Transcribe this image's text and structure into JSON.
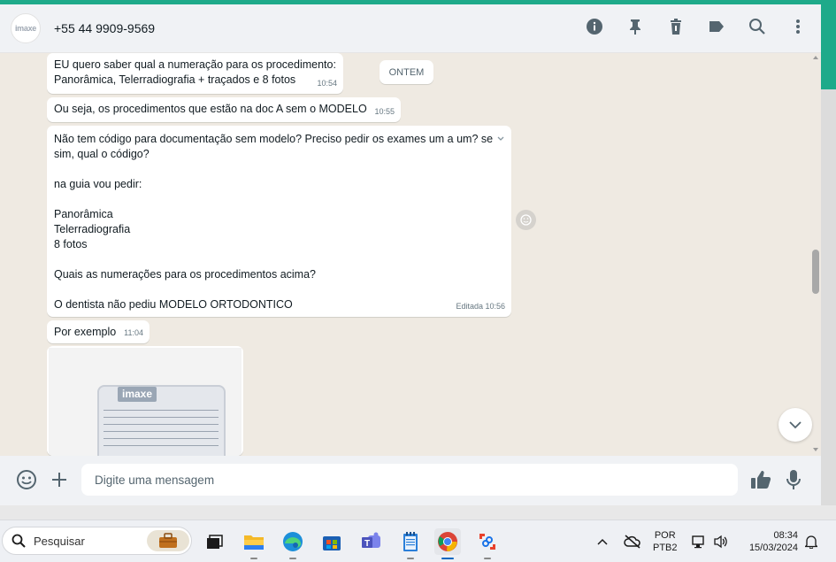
{
  "header": {
    "avatar_text": "imaxe",
    "contact": "+55 44 9909-9569",
    "icons": [
      "info-icon",
      "pin-icon",
      "trash-icon",
      "label-icon",
      "search-icon",
      "more-vertical-icon"
    ]
  },
  "chat": {
    "date_chip": "ONTEM",
    "messages": [
      {
        "text": "EU quero saber qual a numeração para os procedimento:\nPanorâmica, Telerradiografia + traçados e 8 fotos",
        "time": "10:54"
      },
      {
        "text": "Ou seja, os procedimentos que estão na doc A sem o MODELO",
        "time": "10:55"
      },
      {
        "text": "Não tem código para documentação sem modelo? Preciso pedir os exames um a um? se sim, qual o código?\n\nna guia vou pedir:\n\nPanorâmica\nTelerradiografia\n8 fotos\n\nQuais as numerações para os procedimentos acima?\n\nO dentista não pediu MODELO ORTODONTICO",
        "time": "Editada 10:56"
      },
      {
        "text": "Por exemplo",
        "time": "11:04"
      }
    ],
    "image_doc": {
      "brand": "imaxe"
    }
  },
  "composer": {
    "placeholder": "Digite uma mensagem"
  },
  "taskbar": {
    "search_placeholder": "Pesquisar",
    "lang_top": "POR",
    "lang_bottom": "PTB2",
    "time": "08:34",
    "date": "15/03/2024"
  },
  "colors": {
    "accent": "#1faa8a",
    "bubble": "#ffffff",
    "chat_bg": "#efeae2"
  }
}
